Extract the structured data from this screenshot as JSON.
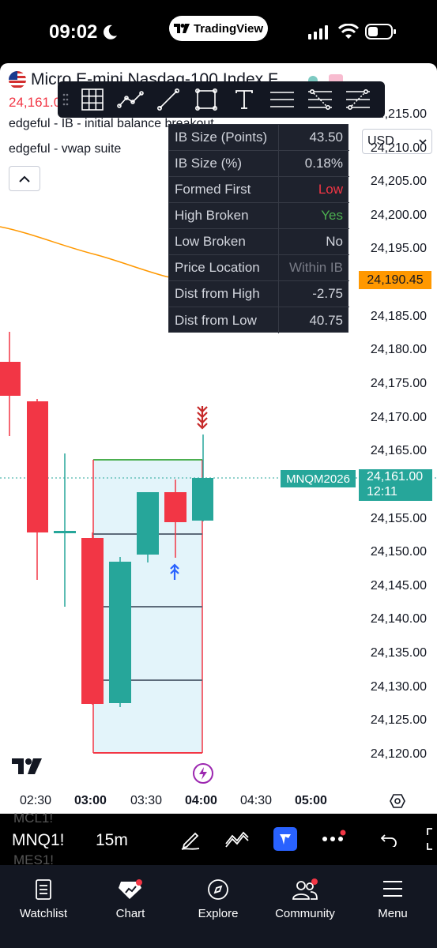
{
  "status_bar": {
    "time": "09:02",
    "app_pill_label": "TradingView"
  },
  "symbol": {
    "name": "Micro E-mini Nasdaq-100 Index F",
    "price": "24,161.0",
    "currency": "USD"
  },
  "indicators": [
    {
      "label": "edgeful - IB - initial balance breakout"
    },
    {
      "label": "edgeful - vwap suite"
    }
  ],
  "drawing_toolbar": {
    "tools": [
      "grid-icon",
      "path-icon",
      "trend-line-icon",
      "rectangle-icon",
      "text-icon",
      "horizontal-lines-icon",
      "fib-levels-icon",
      "projection-icon"
    ]
  },
  "ib_table": {
    "rows": [
      {
        "label": "IB Size (Points)",
        "value": "43.50",
        "color": "#d1d4dc"
      },
      {
        "label": "IB Size (%)",
        "value": "0.18%",
        "color": "#d1d4dc"
      },
      {
        "label": "Formed First",
        "value": "Low",
        "color": "#f23645"
      },
      {
        "label": "High Broken",
        "value": "Yes",
        "color": "#4caf50"
      },
      {
        "label": "Low Broken",
        "value": "No",
        "color": "#d1d4dc"
      },
      {
        "label": "Price Location",
        "value": "Within IB",
        "color": "#787b86"
      },
      {
        "label": "Dist from High",
        "value": "-2.75",
        "color": "#d1d4dc"
      },
      {
        "label": "Dist from Low",
        "value": "40.75",
        "color": "#d1d4dc"
      }
    ]
  },
  "price_scale": {
    "labels": [
      "24,215.00",
      "24,210.00",
      "24,205.00",
      "24,200.00",
      "24,195.00",
      "24,185.00",
      "24,180.00",
      "24,175.00",
      "24,170.00",
      "24,165.00",
      "24,155.00",
      "24,150.00",
      "24,145.00",
      "24,140.00",
      "24,135.00",
      "24,130.00",
      "24,125.00",
      "24,120.00"
    ],
    "vwap_badge": "24,190.45",
    "last_price_badge": "24,161.00",
    "countdown": "12:11",
    "symbol_badge": "MNQM2026"
  },
  "time_axis": {
    "labels": [
      {
        "text": "02:30",
        "bold": false
      },
      {
        "text": "03:00",
        "bold": true
      },
      {
        "text": "03:30",
        "bold": false
      },
      {
        "text": "04:00",
        "bold": true
      },
      {
        "text": "04:30",
        "bold": false
      },
      {
        "text": "05:00",
        "bold": true
      }
    ]
  },
  "bottom_toolbar": {
    "symbol": "MNQ1!",
    "symbol_above": "MCL1!",
    "symbol_below": "MES1!",
    "interval": "15m"
  },
  "tabs": [
    {
      "label": "Watchlist",
      "icon": "watchlist-icon"
    },
    {
      "label": "Chart",
      "icon": "chart-icon"
    },
    {
      "label": "Explore",
      "icon": "compass-icon"
    },
    {
      "label": "Community",
      "icon": "community-icon"
    },
    {
      "label": "Menu",
      "icon": "menu-icon"
    }
  ],
  "colors": {
    "up": "#26a69a",
    "down": "#f23645",
    "vwap": "#ff9800",
    "ib_box": "#e3f4fa",
    "accent": "#2962ff"
  }
}
